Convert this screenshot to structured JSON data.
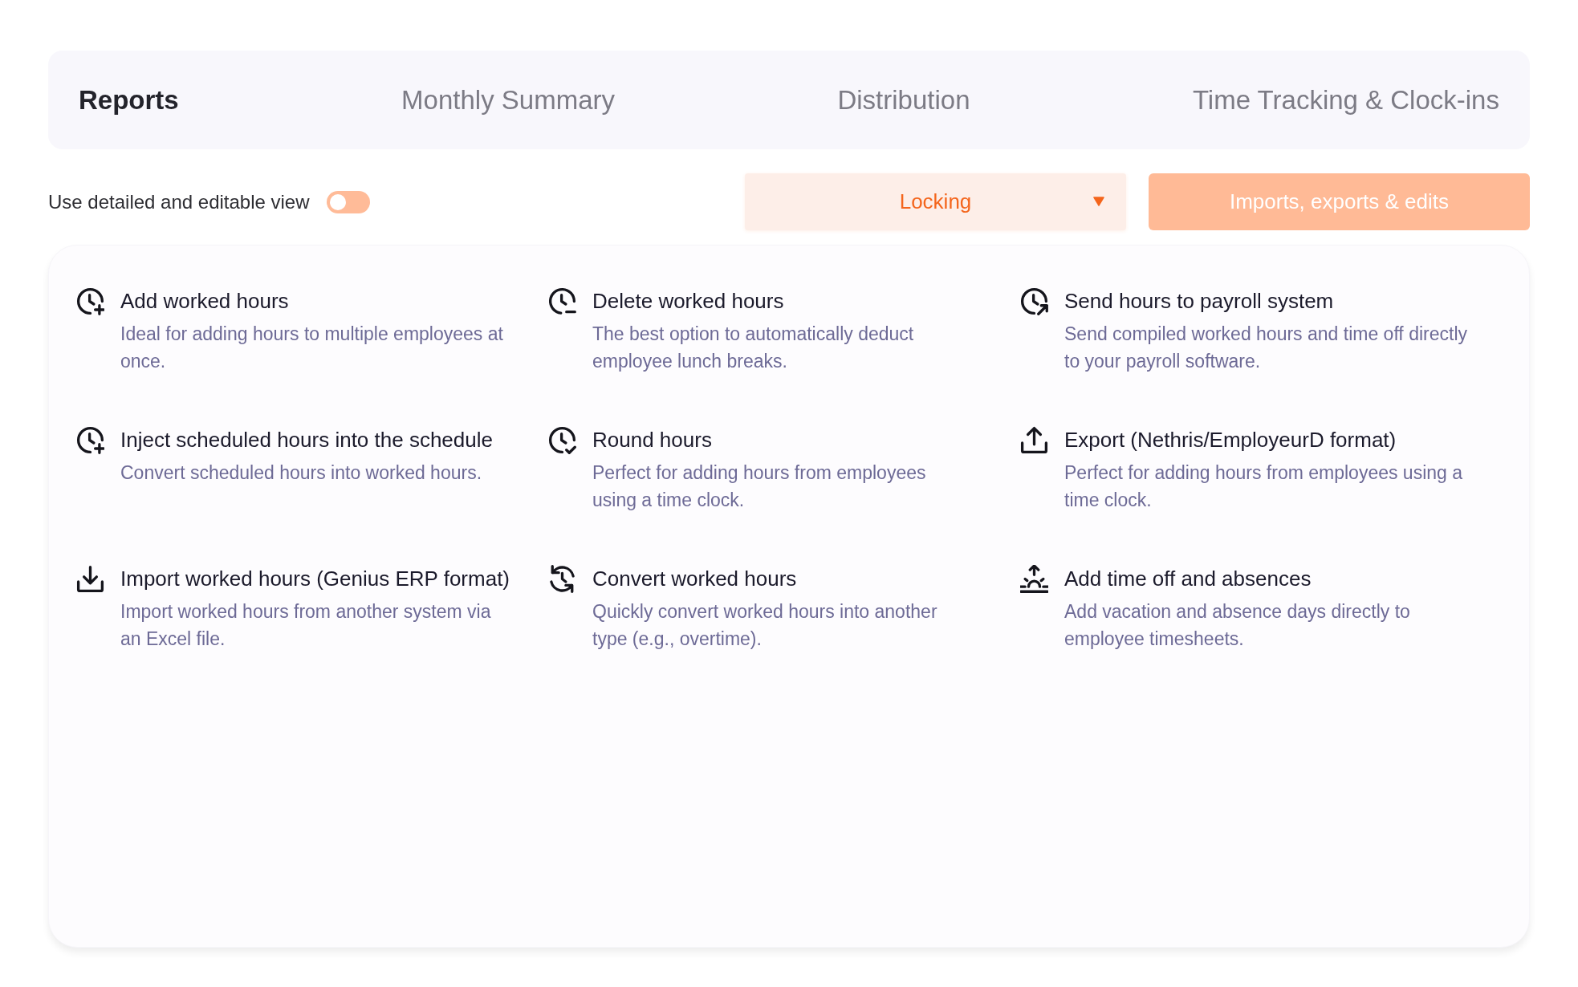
{
  "tabs": [
    {
      "label": "Reports",
      "selected": true
    },
    {
      "label": "Monthly Summary",
      "selected": false
    },
    {
      "label": "Distribution",
      "selected": false
    },
    {
      "label": "Time Tracking & Clock-ins",
      "selected": false
    }
  ],
  "toolbar": {
    "toggle": {
      "label": "Use detailed and editable view",
      "on": false
    },
    "dropdown": {
      "value": "Locking"
    },
    "button": {
      "label": "Imports, exports & edits"
    }
  },
  "actions": [
    {
      "kind": "add",
      "title": "Add worked hours",
      "description": "Ideal for adding hours to multiple employees at once."
    },
    {
      "kind": "delete",
      "title": "Delete worked hours",
      "description": "The best option to automatically deduct employee lunch breaks."
    },
    {
      "kind": "send",
      "title": "Send hours to payroll system",
      "description": "Send compiled worked hours and time off directly to your payroll software."
    },
    {
      "kind": "add",
      "title": "Inject scheduled hours into the schedule",
      "description": "Convert scheduled hours into worked hours."
    },
    {
      "kind": "round",
      "title": "Round hours",
      "description": "Perfect for adding hours from employees using a time clock."
    },
    {
      "kind": "export",
      "title": "Export (Nethris/EmployeurD format)",
      "description": "Perfect for adding hours from employees using a time clock."
    },
    {
      "kind": "import",
      "title": "Import worked hours (Genius ERP format)",
      "description": "Import worked hours from another system via an Excel file."
    },
    {
      "kind": "convert",
      "title": "Convert worked hours",
      "description": "Quickly convert worked hours into another type (e.g., overtime)."
    },
    {
      "kind": "timeoff",
      "title": "Add time off and absences",
      "description": "Add vacation and absence days directly to employee timesheets."
    }
  ]
}
